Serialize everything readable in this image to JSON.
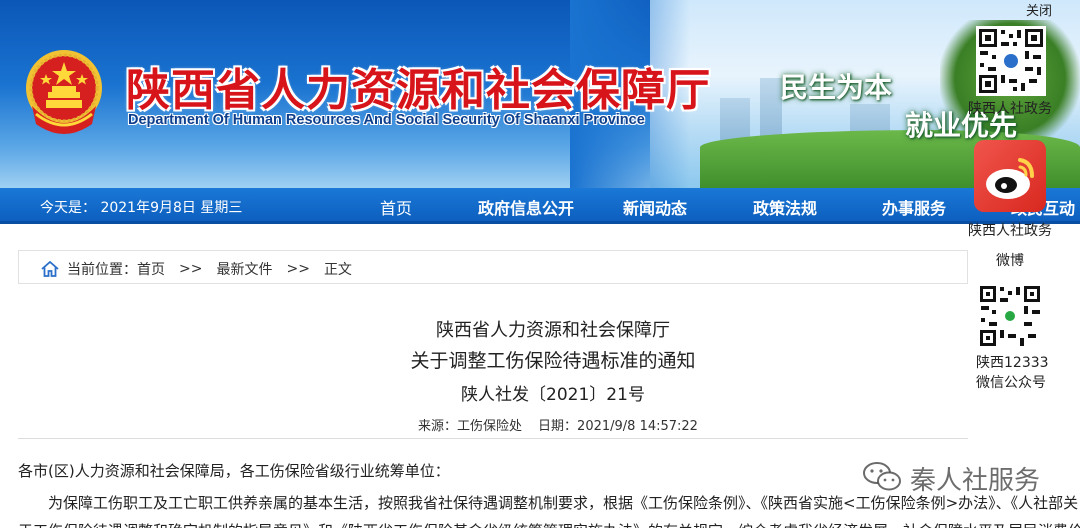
{
  "header": {
    "title_cn": "陕西省人力资源和社会保障厅",
    "title_en": "Department Of Human Resources And Social Security Of Shaanxi Province",
    "slogan_line1": "民生为本",
    "slogan_line2": "就业优先",
    "emblem_icon": "national-emblem-icon"
  },
  "navbar": {
    "date": "今天是： 2021年9月8日 星期三",
    "items": [
      {
        "label": "首页"
      },
      {
        "label": "政府信息公开"
      },
      {
        "label": "新闻动态"
      },
      {
        "label": "政策法规"
      },
      {
        "label": "办事服务"
      },
      {
        "label": "政民互动"
      }
    ]
  },
  "breadcrumb": {
    "prefix": "当前位置：",
    "items": [
      "首页",
      "最新文件",
      "正文"
    ],
    "separator": ">>",
    "icon": "home-icon"
  },
  "article": {
    "org": "陕西省人力资源和社会保障厅",
    "title": "关于调整工伤保险待遇标准的通知",
    "doc_number": "陕人社发〔2021〕21号",
    "source_label": "来源：",
    "source": "工伤保险处",
    "date_label": "日期：",
    "date": "2021/9/8 14:57:22",
    "para1": "各市(区)人力资源和社会保障局，各工伤保险省级行业统筹单位：",
    "para2": "为保障工伤职工及工亡职工供养亲属的基本生活，按照我省社保待遇调整机制要求，根据《工伤保险条例》、《陕西省实施<工伤保险条例>办法》、《人社部关",
    "para3": "于工伤保险待遇调整和确定机制的指导意见》和《陕西省工伤保险基金省级统筹管理实施办法》的有关规定，综合考虑我省经济发展、社会保障水平及居民消费价格"
  },
  "side_panel": {
    "close": "关闭",
    "qr1_label": "陕西人社政务",
    "weibo_label1": "陕西人社政务",
    "weibo_label2": "微博",
    "qr2_label1": "陕西12333",
    "qr2_label2": "微信公众号"
  },
  "watermark": {
    "text": "秦人社服务",
    "icon": "wechat-icon"
  },
  "colors": {
    "nav_blue": "#0d5fbf",
    "title_red": "#d8141b",
    "en_blue": "#0e3f8d"
  }
}
